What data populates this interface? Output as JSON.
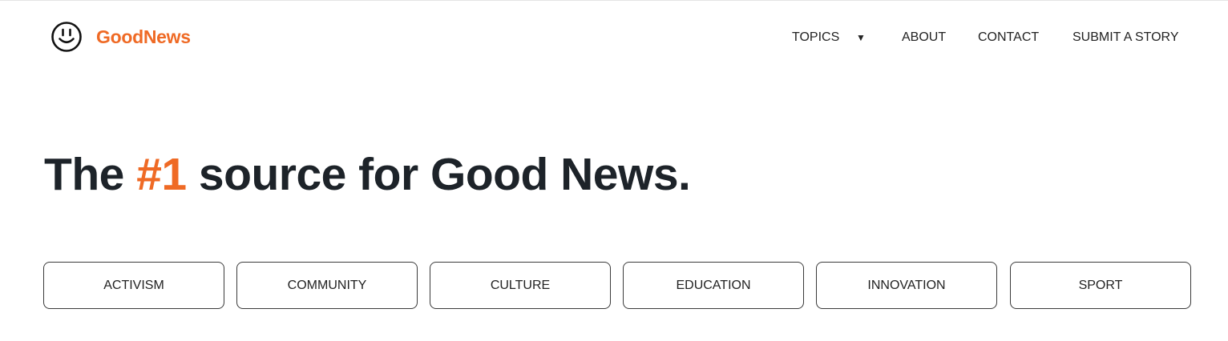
{
  "brand": {
    "name": "GoodNews",
    "icon": "smiley-face-icon",
    "color": "#ef6a25"
  },
  "nav": {
    "topics": "TOPICS",
    "topics_caret": "▼",
    "about": "ABOUT",
    "contact": "CONTACT",
    "submit": "SUBMIT A STORY"
  },
  "hero": {
    "prefix": "The ",
    "accent": "#1",
    "suffix": " source for Good News."
  },
  "topics": [
    "ACTIVISM",
    "COMMUNITY",
    "CULTURE",
    "EDUCATION",
    "INNOVATION",
    "SPORT"
  ],
  "colors": {
    "accent": "#ef6a25",
    "text": "#1d2329"
  }
}
